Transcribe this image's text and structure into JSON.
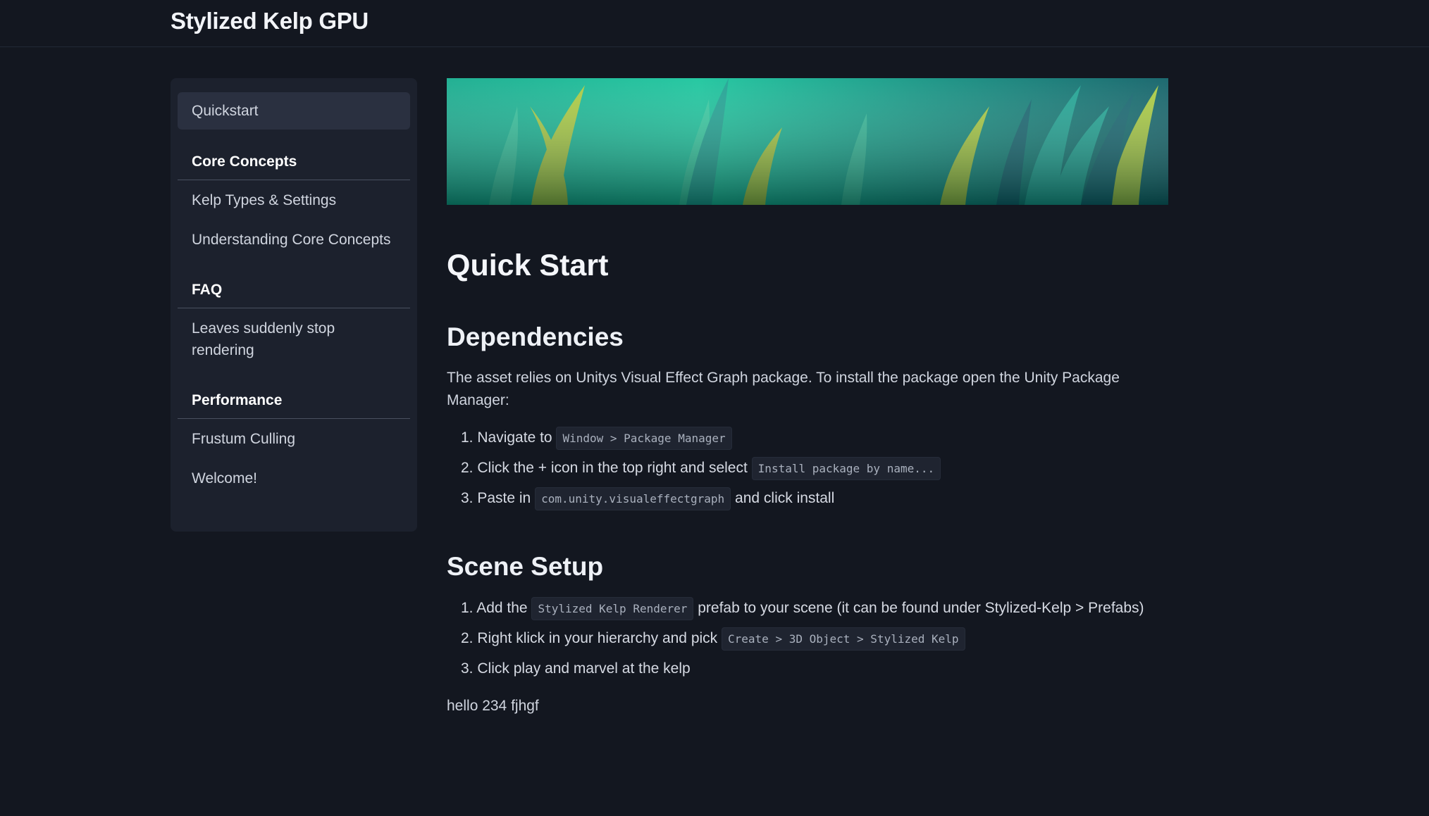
{
  "site": {
    "title": "Stylized Kelp GPU"
  },
  "sidebar": {
    "active_item": "Quickstart",
    "sections": [
      {
        "heading": "Core Concepts",
        "items": [
          "Kelp Types & Settings",
          "Understanding Core Concepts"
        ]
      },
      {
        "heading": "FAQ",
        "items": [
          "Leaves suddenly stop rendering"
        ]
      },
      {
        "heading": "Performance",
        "items": [
          "Frustum Culling",
          "Welcome!"
        ]
      }
    ]
  },
  "content": {
    "page_title": "Quick Start",
    "dependencies": {
      "heading": "Dependencies",
      "intro": "The asset relies on Unitys Visual Effect Graph package. To install the package open the Unity Package Manager:",
      "steps": [
        {
          "num": "1.",
          "pre": "Navigate to",
          "code": "Window > Package Manager",
          "post": ""
        },
        {
          "num": "2.",
          "pre": "Click the + icon in the top right and select",
          "code": "Install package by name...",
          "post": ""
        },
        {
          "num": "3.",
          "pre": "Paste in",
          "code": "com.unity.visualeffectgraph",
          "post": "and click install"
        }
      ]
    },
    "scene_setup": {
      "heading": "Scene Setup",
      "steps": [
        {
          "num": "1.",
          "pre": "Add the",
          "code": "Stylized Kelp Renderer",
          "post": "prefab to your scene (it can be found under Stylized-Kelp > Prefabs)"
        },
        {
          "num": "2.",
          "pre": "Right klick in your hierarchy and pick",
          "code": "Create > 3D Object > Stylized Kelp",
          "post": ""
        },
        {
          "num": "3.",
          "pre": "Click play and marvel at the kelp",
          "code": "",
          "post": ""
        }
      ]
    },
    "footer_text": "hello 234 fjhgf"
  },
  "colors": {
    "background": "#131720",
    "sidebar": "#1c212d",
    "active_item": "#2a3040",
    "code_bg": "#1f2430"
  }
}
